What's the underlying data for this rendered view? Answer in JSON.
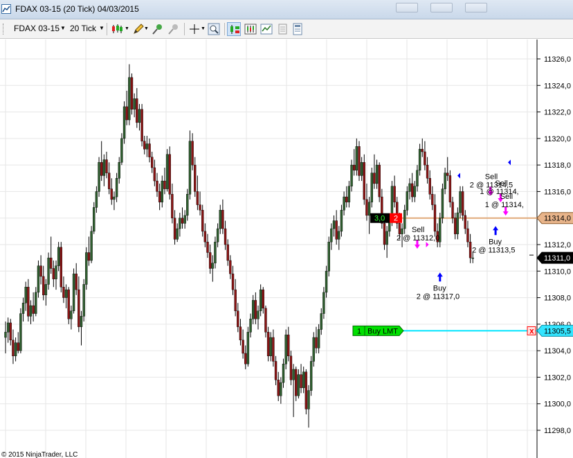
{
  "window": {
    "title": "FDAX 03-15 (20 Tick)  04/03/2015"
  },
  "toolbar": {
    "instrument": "FDAX 03-15",
    "interval": "20 Tick",
    "buttons": [
      "bar-type-icon",
      "pencil-draw-icon",
      "pin-icon",
      "link-icon",
      "crosshair-icon",
      "zoom-icon",
      "chart-trader-icon",
      "data-box-icon",
      "indicator-icon",
      "properties-icon",
      "strategy-icon"
    ]
  },
  "copyright": "© 2015 NinjaTrader, LLC",
  "colors": {
    "up_body": "#2f5f2f",
    "down_body": "#8b1414",
    "wick": "#000000",
    "position_line": "#e0a878",
    "order_line": "#00e5ff",
    "buy_marker": "#0000ff",
    "sell_marker": "#ff00ff"
  },
  "chart_data": {
    "type": "candlestick",
    "title": "FDAX 03-15 (20 Tick)",
    "ylim": [
      11298,
      11326
    ],
    "y_ticks": [
      "11326,0",
      "11324,0",
      "11322,0",
      "11320,0",
      "11318,0",
      "11316,0",
      "11314,0",
      "11312,0",
      "11310,0",
      "11308,0",
      "11306,0",
      "11304,0",
      "11302,0",
      "11300,0",
      "11298,0"
    ],
    "grid": true,
    "price_markers": [
      {
        "label": "11314,0",
        "value": 11314.0,
        "kind": "position"
      },
      {
        "label": "11311,0",
        "value": 11311.0,
        "kind": "last"
      },
      {
        "label": "11305,5",
        "value": 11305.5,
        "kind": "order"
      }
    ],
    "position_box": {
      "quantity": "3,0",
      "orders": "2",
      "value": 11314.0
    },
    "working_order": {
      "quantity": "1",
      "label": "Buy LMT",
      "value": 11305.5,
      "cancel": "x"
    },
    "executions": [
      {
        "side": "Sell",
        "text": "2 @ 11312,0",
        "value": 11312.0,
        "bar": 163
      },
      {
        "side": "Buy",
        "text": "2 @ 11317,0",
        "value": 11310.0,
        "bar": 172
      },
      {
        "side": "Sell",
        "text": "2 @ 11314,5",
        "value": 11316.0,
        "bar": 192
      },
      {
        "side": "Sell",
        "text": "1 @ 11314,",
        "value": 11315.5,
        "bar": 196
      },
      {
        "side": "Sell",
        "text": "1 @ 11314,",
        "value": 11314.5,
        "bar": 198
      },
      {
        "side": "Buy",
        "text": "2 @ 11313,5",
        "value": 11313.5,
        "bar": 194
      }
    ],
    "candles": [
      [
        11305.0,
        11306.2,
        11303.8,
        11305.4
      ],
      [
        11305.4,
        11306.5,
        11304.6,
        11306.1
      ],
      [
        11306.1,
        11306.4,
        11304.4,
        11304.8
      ],
      [
        11304.8,
        11305.6,
        11303.0,
        11303.6
      ],
      [
        11303.6,
        11305.0,
        11303.2,
        11304.6
      ],
      [
        11304.6,
        11305.4,
        11303.8,
        11304.0
      ],
      [
        11304.0,
        11307.2,
        11303.8,
        11306.8
      ],
      [
        11306.8,
        11308.0,
        11306.2,
        11307.6
      ],
      [
        11307.6,
        11309.2,
        11307.0,
        11308.8
      ],
      [
        11308.8,
        11309.4,
        11306.2,
        11306.6
      ],
      [
        11306.6,
        11307.8,
        11306.0,
        11307.4
      ],
      [
        11307.4,
        11308.4,
        11306.2,
        11306.8
      ],
      [
        11306.8,
        11308.8,
        11306.6,
        11308.4
      ],
      [
        11308.4,
        11310.8,
        11308.0,
        11310.4
      ],
      [
        11310.4,
        11311.2,
        11309.0,
        11309.6
      ],
      [
        11309.6,
        11310.4,
        11307.8,
        11308.2
      ],
      [
        11308.2,
        11309.4,
        11307.4,
        11309.0
      ],
      [
        11309.0,
        11311.4,
        11308.6,
        11311.0
      ],
      [
        11311.0,
        11312.6,
        11309.8,
        11310.2
      ],
      [
        11310.2,
        11310.8,
        11308.8,
        11309.4
      ],
      [
        11309.4,
        11310.8,
        11308.6,
        11310.4
      ],
      [
        11310.4,
        11312.2,
        11310.0,
        11311.8
      ],
      [
        11311.8,
        11312.2,
        11308.4,
        11308.8
      ],
      [
        11308.8,
        11309.6,
        11307.6,
        11308.0
      ],
      [
        11308.0,
        11309.0,
        11307.2,
        11308.6
      ],
      [
        11308.6,
        11308.8,
        11306.0,
        11306.4
      ],
      [
        11306.4,
        11307.4,
        11305.6,
        11307.0
      ],
      [
        11307.0,
        11310.2,
        11306.8,
        11309.8
      ],
      [
        11309.8,
        11310.6,
        11308.2,
        11308.6
      ],
      [
        11308.6,
        11309.6,
        11305.4,
        11305.8
      ],
      [
        11305.8,
        11307.0,
        11304.4,
        11306.6
      ],
      [
        11306.6,
        11309.4,
        11306.2,
        11309.0
      ],
      [
        11309.0,
        11311.8,
        11308.6,
        11311.4
      ],
      [
        11311.4,
        11312.6,
        11310.4,
        11310.8
      ],
      [
        11310.8,
        11313.4,
        11310.6,
        11313.0
      ],
      [
        11313.0,
        11315.2,
        11312.8,
        11314.8
      ],
      [
        11314.8,
        11316.4,
        11314.4,
        11316.0
      ],
      [
        11316.0,
        11318.6,
        11315.6,
        11318.2
      ],
      [
        11318.2,
        11319.8,
        11316.8,
        11317.2
      ],
      [
        11317.2,
        11318.8,
        11316.4,
        11318.4
      ],
      [
        11318.4,
        11319.0,
        11317.0,
        11317.4
      ],
      [
        11317.4,
        11318.2,
        11315.8,
        11316.2
      ],
      [
        11316.2,
        11317.0,
        11315.0,
        11315.4
      ],
      [
        11315.4,
        11316.0,
        11314.6,
        11315.6
      ],
      [
        11315.6,
        11317.4,
        11315.2,
        11317.0
      ],
      [
        11317.0,
        11318.6,
        11316.6,
        11318.2
      ],
      [
        11318.2,
        11320.4,
        11318.0,
        11320.0
      ],
      [
        11320.0,
        11322.8,
        11319.6,
        11322.4
      ],
      [
        11322.4,
        11323.6,
        11321.0,
        11321.4
      ],
      [
        11321.4,
        11325.6,
        11321.0,
        11324.6
      ],
      [
        11324.6,
        11324.9,
        11321.8,
        11322.2
      ],
      [
        11322.2,
        11323.4,
        11321.6,
        11323.0
      ],
      [
        11323.0,
        11323.8,
        11320.8,
        11321.2
      ],
      [
        11321.2,
        11322.6,
        11320.6,
        11322.2
      ],
      [
        11322.2,
        11322.6,
        11319.4,
        11319.8
      ],
      [
        11319.8,
        11320.2,
        11318.8,
        11319.2
      ],
      [
        11319.2,
        11320.2,
        11318.6,
        11319.6
      ],
      [
        11319.6,
        11320.0,
        11318.2,
        11318.6
      ],
      [
        11318.6,
        11319.0,
        11317.4,
        11317.8
      ],
      [
        11317.8,
        11318.4,
        11316.4,
        11316.8
      ],
      [
        11316.8,
        11317.4,
        11315.6,
        11316.0
      ],
      [
        11316.0,
        11316.6,
        11314.6,
        11315.2
      ],
      [
        11315.2,
        11317.2,
        11314.8,
        11316.8
      ],
      [
        11316.8,
        11317.8,
        11315.8,
        11316.2
      ],
      [
        11316.2,
        11319.2,
        11316.0,
        11318.8
      ],
      [
        11318.8,
        11319.4,
        11315.4,
        11315.8
      ],
      [
        11315.8,
        11316.6,
        11313.6,
        11314.0
      ],
      [
        11314.0,
        11314.6,
        11312.0,
        11312.4
      ],
      [
        11312.4,
        11313.6,
        11312.2,
        11313.2
      ],
      [
        11313.2,
        11314.4,
        11312.6,
        11314.0
      ],
      [
        11314.0,
        11314.8,
        11313.2,
        11313.6
      ],
      [
        11313.6,
        11314.6,
        11313.2,
        11314.2
      ],
      [
        11314.2,
        11316.2,
        11313.8,
        11315.8
      ],
      [
        11315.8,
        11320.6,
        11315.4,
        11319.8
      ],
      [
        11319.8,
        11320.4,
        11317.6,
        11318.0
      ],
      [
        11318.0,
        11318.6,
        11315.6,
        11316.0
      ],
      [
        11316.0,
        11317.2,
        11314.6,
        11315.0
      ],
      [
        11315.0,
        11316.0,
        11314.2,
        11314.6
      ],
      [
        11314.6,
        11315.0,
        11312.6,
        11313.0
      ],
      [
        11313.0,
        11313.6,
        11311.8,
        11312.2
      ],
      [
        11312.2,
        11312.8,
        11311.0,
        11311.4
      ],
      [
        11311.4,
        11312.0,
        11309.8,
        11310.2
      ],
      [
        11310.2,
        11311.2,
        11309.2,
        11310.6
      ],
      [
        11310.6,
        11312.6,
        11310.2,
        11312.2
      ],
      [
        11312.2,
        11313.6,
        11311.8,
        11313.2
      ],
      [
        11313.2,
        11315.0,
        11312.8,
        11314.6
      ],
      [
        11314.6,
        11315.4,
        11312.8,
        11313.2
      ],
      [
        11313.2,
        11313.8,
        11311.6,
        11312.0
      ],
      [
        11312.0,
        11312.4,
        11310.4,
        11310.8
      ],
      [
        11310.8,
        11311.2,
        11309.4,
        11309.8
      ],
      [
        11309.8,
        11310.4,
        11308.2,
        11308.6
      ],
      [
        11308.6,
        11309.4,
        11306.6,
        11307.0
      ],
      [
        11307.0,
        11307.6,
        11305.4,
        11305.8
      ],
      [
        11305.8,
        11306.4,
        11304.4,
        11304.8
      ],
      [
        11304.8,
        11305.6,
        11303.4,
        11303.8
      ],
      [
        11303.8,
        11304.4,
        11302.6,
        11303.0
      ],
      [
        11303.0,
        11305.8,
        11302.8,
        11305.4
      ],
      [
        11305.4,
        11306.8,
        11305.0,
        11306.4
      ],
      [
        11306.4,
        11308.2,
        11306.0,
        11307.8
      ],
      [
        11307.8,
        11308.4,
        11306.0,
        11306.4
      ],
      [
        11306.4,
        11307.4,
        11305.6,
        11307.0
      ],
      [
        11307.0,
        11309.0,
        11306.6,
        11308.6
      ],
      [
        11308.6,
        11308.8,
        11306.8,
        11307.2
      ],
      [
        11307.2,
        11307.4,
        11305.0,
        11305.4
      ],
      [
        11305.4,
        11305.8,
        11303.2,
        11303.6
      ],
      [
        11303.6,
        11305.4,
        11303.2,
        11305.0
      ],
      [
        11305.0,
        11305.6,
        11302.8,
        11303.2
      ],
      [
        11303.2,
        11303.6,
        11301.4,
        11301.8
      ],
      [
        11301.8,
        11302.4,
        11300.2,
        11300.6
      ],
      [
        11300.6,
        11302.0,
        11300.0,
        11301.6
      ],
      [
        11301.6,
        11303.4,
        11301.2,
        11303.0
      ],
      [
        11303.0,
        11305.6,
        11302.6,
        11305.2
      ],
      [
        11305.2,
        11305.8,
        11303.2,
        11303.6
      ],
      [
        11303.6,
        11304.0,
        11301.4,
        11301.8
      ],
      [
        11301.8,
        11303.0,
        11299.0,
        11302.6
      ],
      [
        11302.6,
        11302.8,
        11300.2,
        11300.6
      ],
      [
        11300.6,
        11302.6,
        11300.4,
        11302.2
      ],
      [
        11302.2,
        11303.0,
        11300.8,
        11301.2
      ],
      [
        11301.2,
        11302.8,
        11300.8,
        11302.4
      ],
      [
        11302.4,
        11302.6,
        11299.2,
        11299.6
      ],
      [
        11299.6,
        11301.4,
        11298.2,
        11301.0
      ],
      [
        11301.0,
        11303.6,
        11300.6,
        11303.2
      ],
      [
        11303.2,
        11305.4,
        11302.8,
        11305.0
      ],
      [
        11305.0,
        11305.8,
        11303.8,
        11304.2
      ],
      [
        11304.2,
        11306.0,
        11303.8,
        11305.6
      ],
      [
        11305.6,
        11307.2,
        11305.2,
        11306.8
      ],
      [
        11306.8,
        11308.8,
        11306.4,
        11308.4
      ],
      [
        11308.4,
        11310.4,
        11308.0,
        11310.0
      ],
      [
        11310.0,
        11312.6,
        11309.6,
        11312.2
      ],
      [
        11312.2,
        11313.6,
        11311.6,
        11313.2
      ],
      [
        11313.2,
        11314.2,
        11312.6,
        11313.8
      ],
      [
        11313.8,
        11314.6,
        11312.0,
        11312.4
      ],
      [
        11312.4,
        11313.4,
        11311.6,
        11313.0
      ],
      [
        11313.0,
        11315.0,
        11312.6,
        11314.6
      ],
      [
        11314.6,
        11316.0,
        11314.2,
        11315.6
      ],
      [
        11315.6,
        11316.4,
        11314.8,
        11315.2
      ],
      [
        11315.2,
        11316.8,
        11314.8,
        11316.4
      ],
      [
        11316.4,
        11318.4,
        11316.0,
        11318.0
      ],
      [
        11318.0,
        11319.2,
        11317.2,
        11317.6
      ],
      [
        11317.6,
        11320.0,
        11317.2,
        11319.4
      ],
      [
        11319.4,
        11319.8,
        11316.8,
        11317.2
      ],
      [
        11317.2,
        11318.6,
        11316.8,
        11318.2
      ],
      [
        11318.2,
        11318.8,
        11315.0,
        11315.4
      ],
      [
        11315.4,
        11316.6,
        11313.8,
        11314.2
      ],
      [
        11314.2,
        11315.6,
        11312.8,
        11315.2
      ],
      [
        11315.2,
        11317.8,
        11314.8,
        11317.4
      ],
      [
        11317.4,
        11318.8,
        11316.2,
        11316.6
      ],
      [
        11316.6,
        11318.4,
        11316.2,
        11318.0
      ],
      [
        11318.0,
        11318.2,
        11315.2,
        11315.6
      ],
      [
        11315.6,
        11316.2,
        11313.2,
        11313.6
      ],
      [
        11313.6,
        11314.0,
        11311.6,
        11312.0
      ],
      [
        11312.0,
        11313.4,
        11311.0,
        11313.0
      ],
      [
        11313.0,
        11314.2,
        11312.6,
        11313.8
      ],
      [
        11313.8,
        11316.8,
        11313.4,
        11316.4
      ],
      [
        11316.4,
        11317.2,
        11314.8,
        11315.2
      ],
      [
        11315.2,
        11315.6,
        11313.2,
        11313.6
      ],
      [
        11313.6,
        11314.4,
        11312.4,
        11312.8
      ],
      [
        11312.8,
        11313.6,
        11311.8,
        11313.2
      ],
      [
        11313.2,
        11315.0,
        11312.8,
        11314.6
      ],
      [
        11314.6,
        11316.4,
        11314.2,
        11316.0
      ],
      [
        11316.0,
        11317.0,
        11315.4,
        11316.6
      ],
      [
        11316.6,
        11317.4,
        11315.2,
        11315.6
      ],
      [
        11315.6,
        11316.8,
        11315.2,
        11316.4
      ],
      [
        11316.4,
        11318.0,
        11316.0,
        11317.6
      ],
      [
        11317.6,
        11319.6,
        11317.2,
        11319.2
      ],
      [
        11319.2,
        11320.0,
        11318.6,
        11319.0
      ],
      [
        11319.0,
        11319.8,
        11317.6,
        11318.0
      ],
      [
        11318.0,
        11318.6,
        11316.6,
        11317.0
      ],
      [
        11317.0,
        11317.6,
        11315.4,
        11315.8
      ],
      [
        11315.8,
        11316.4,
        11314.6,
        11315.0
      ],
      [
        11315.0,
        11315.8,
        11312.6,
        11313.0
      ],
      [
        11313.0,
        11313.6,
        11311.8,
        11312.2
      ],
      [
        11312.2,
        11314.4,
        11311.8,
        11314.0
      ],
      [
        11314.0,
        11316.6,
        11313.6,
        11316.2
      ],
      [
        11316.2,
        11317.8,
        11315.8,
        11317.4
      ],
      [
        11317.4,
        11318.6,
        11316.8,
        11317.2
      ],
      [
        11317.2,
        11317.6,
        11314.8,
        11315.2
      ],
      [
        11315.2,
        11315.6,
        11313.6,
        11314.0
      ],
      [
        11314.0,
        11314.4,
        11312.4,
        11312.8
      ],
      [
        11312.8,
        11314.8,
        11312.4,
        11314.4
      ],
      [
        11314.4,
        11316.4,
        11314.0,
        11316.0
      ],
      [
        11316.0,
        11316.4,
        11313.8,
        11314.2
      ],
      [
        11314.2,
        11314.6,
        11312.8,
        11313.2
      ],
      [
        11313.2,
        11313.8,
        11311.8,
        11312.2
      ],
      [
        11312.2,
        11312.8,
        11310.6,
        11311.0
      ],
      [
        11311.0,
        11311.4,
        11310.6,
        11311.0
      ]
    ]
  }
}
